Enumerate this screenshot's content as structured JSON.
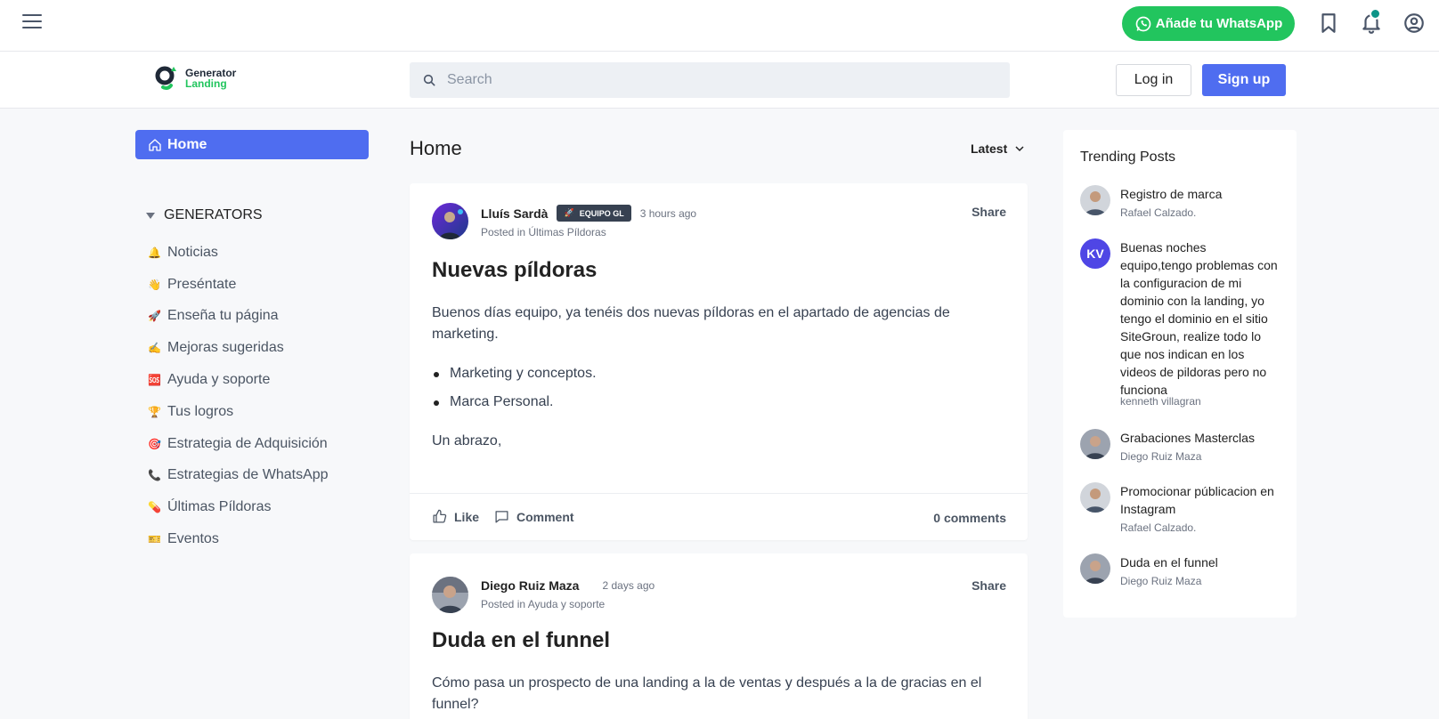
{
  "topbar": {
    "whatsapp_label": "Añade tu WhatsApp",
    "accent": "#22c55e",
    "notification_dot_color": "#0d9488"
  },
  "header": {
    "logo_line1": "Generator",
    "logo_line2": "Landing",
    "search_placeholder": "Search",
    "login_label": "Log in",
    "signup_label": "Sign up",
    "brand_color": "#4f6df0"
  },
  "sidebar": {
    "home_label": "Home",
    "section_label": "GENERATORS",
    "items": [
      {
        "emoji": "🔔",
        "label": "Noticias"
      },
      {
        "emoji": "👋",
        "label": "Preséntate"
      },
      {
        "emoji": "🚀",
        "label": "Enseña tu página"
      },
      {
        "emoji": "✍️",
        "label": "Mejoras sugeridas"
      },
      {
        "emoji": "🆘",
        "label": "Ayuda y soporte"
      },
      {
        "emoji": "🏆",
        "label": "Tus logros"
      },
      {
        "emoji": "🎯",
        "label": "Estrategia de Adquisición"
      },
      {
        "emoji": "📞",
        "label": "Estrategias de WhatsApp"
      },
      {
        "emoji": "💊",
        "label": "Últimas Píldoras"
      },
      {
        "emoji": "🎫",
        "label": "Eventos"
      }
    ]
  },
  "feed": {
    "title": "Home",
    "sort_label": "Latest",
    "posts": [
      {
        "author": "Lluís Sardà",
        "badge": "EQUIPO GL",
        "time": "3 hours ago",
        "posted_in": "Posted in Últimas Píldoras",
        "share_label": "Share",
        "title": "Nuevas píldoras",
        "body_intro": "Buenos días equipo, ya tenéis dos nuevas píldoras en el apartado de agencias de marketing.",
        "bullets": [
          "Marketing y conceptos.",
          "Marca Personal."
        ],
        "body_outro": "Un abrazo,",
        "like_label": "Like",
        "comment_label": "Comment",
        "comments_count": "0 comments"
      },
      {
        "author": "Diego Ruiz Maza",
        "time": "2 days ago",
        "posted_in": "Posted in Ayuda y soporte",
        "share_label": "Share",
        "title": "Duda en el funnel",
        "body_intro": "Cómo pasa un prospecto de una landing a la de ventas y después a la de gracias en el funnel?"
      }
    ]
  },
  "trending": {
    "title": "Trending Posts",
    "items": [
      {
        "title": "Registro de marca",
        "author": "Rafael Calzado."
      },
      {
        "title": "Buenas noches equipo,tengo problemas con la configuracion de mi dominio con la landing, yo tengo el dominio en el sitio SiteGroun, realize todo lo que nos indican en los videos de pildoras pero no funciona",
        "author": "kenneth villagran",
        "initials": "KV"
      },
      {
        "title": "Grabaciones Masterclas",
        "author": "Diego Ruiz Maza"
      },
      {
        "title": "Promocionar públicacion en Instagram",
        "author": "Rafael Calzado."
      },
      {
        "title": "Duda en el funnel",
        "author": "Diego Ruiz Maza"
      }
    ]
  }
}
